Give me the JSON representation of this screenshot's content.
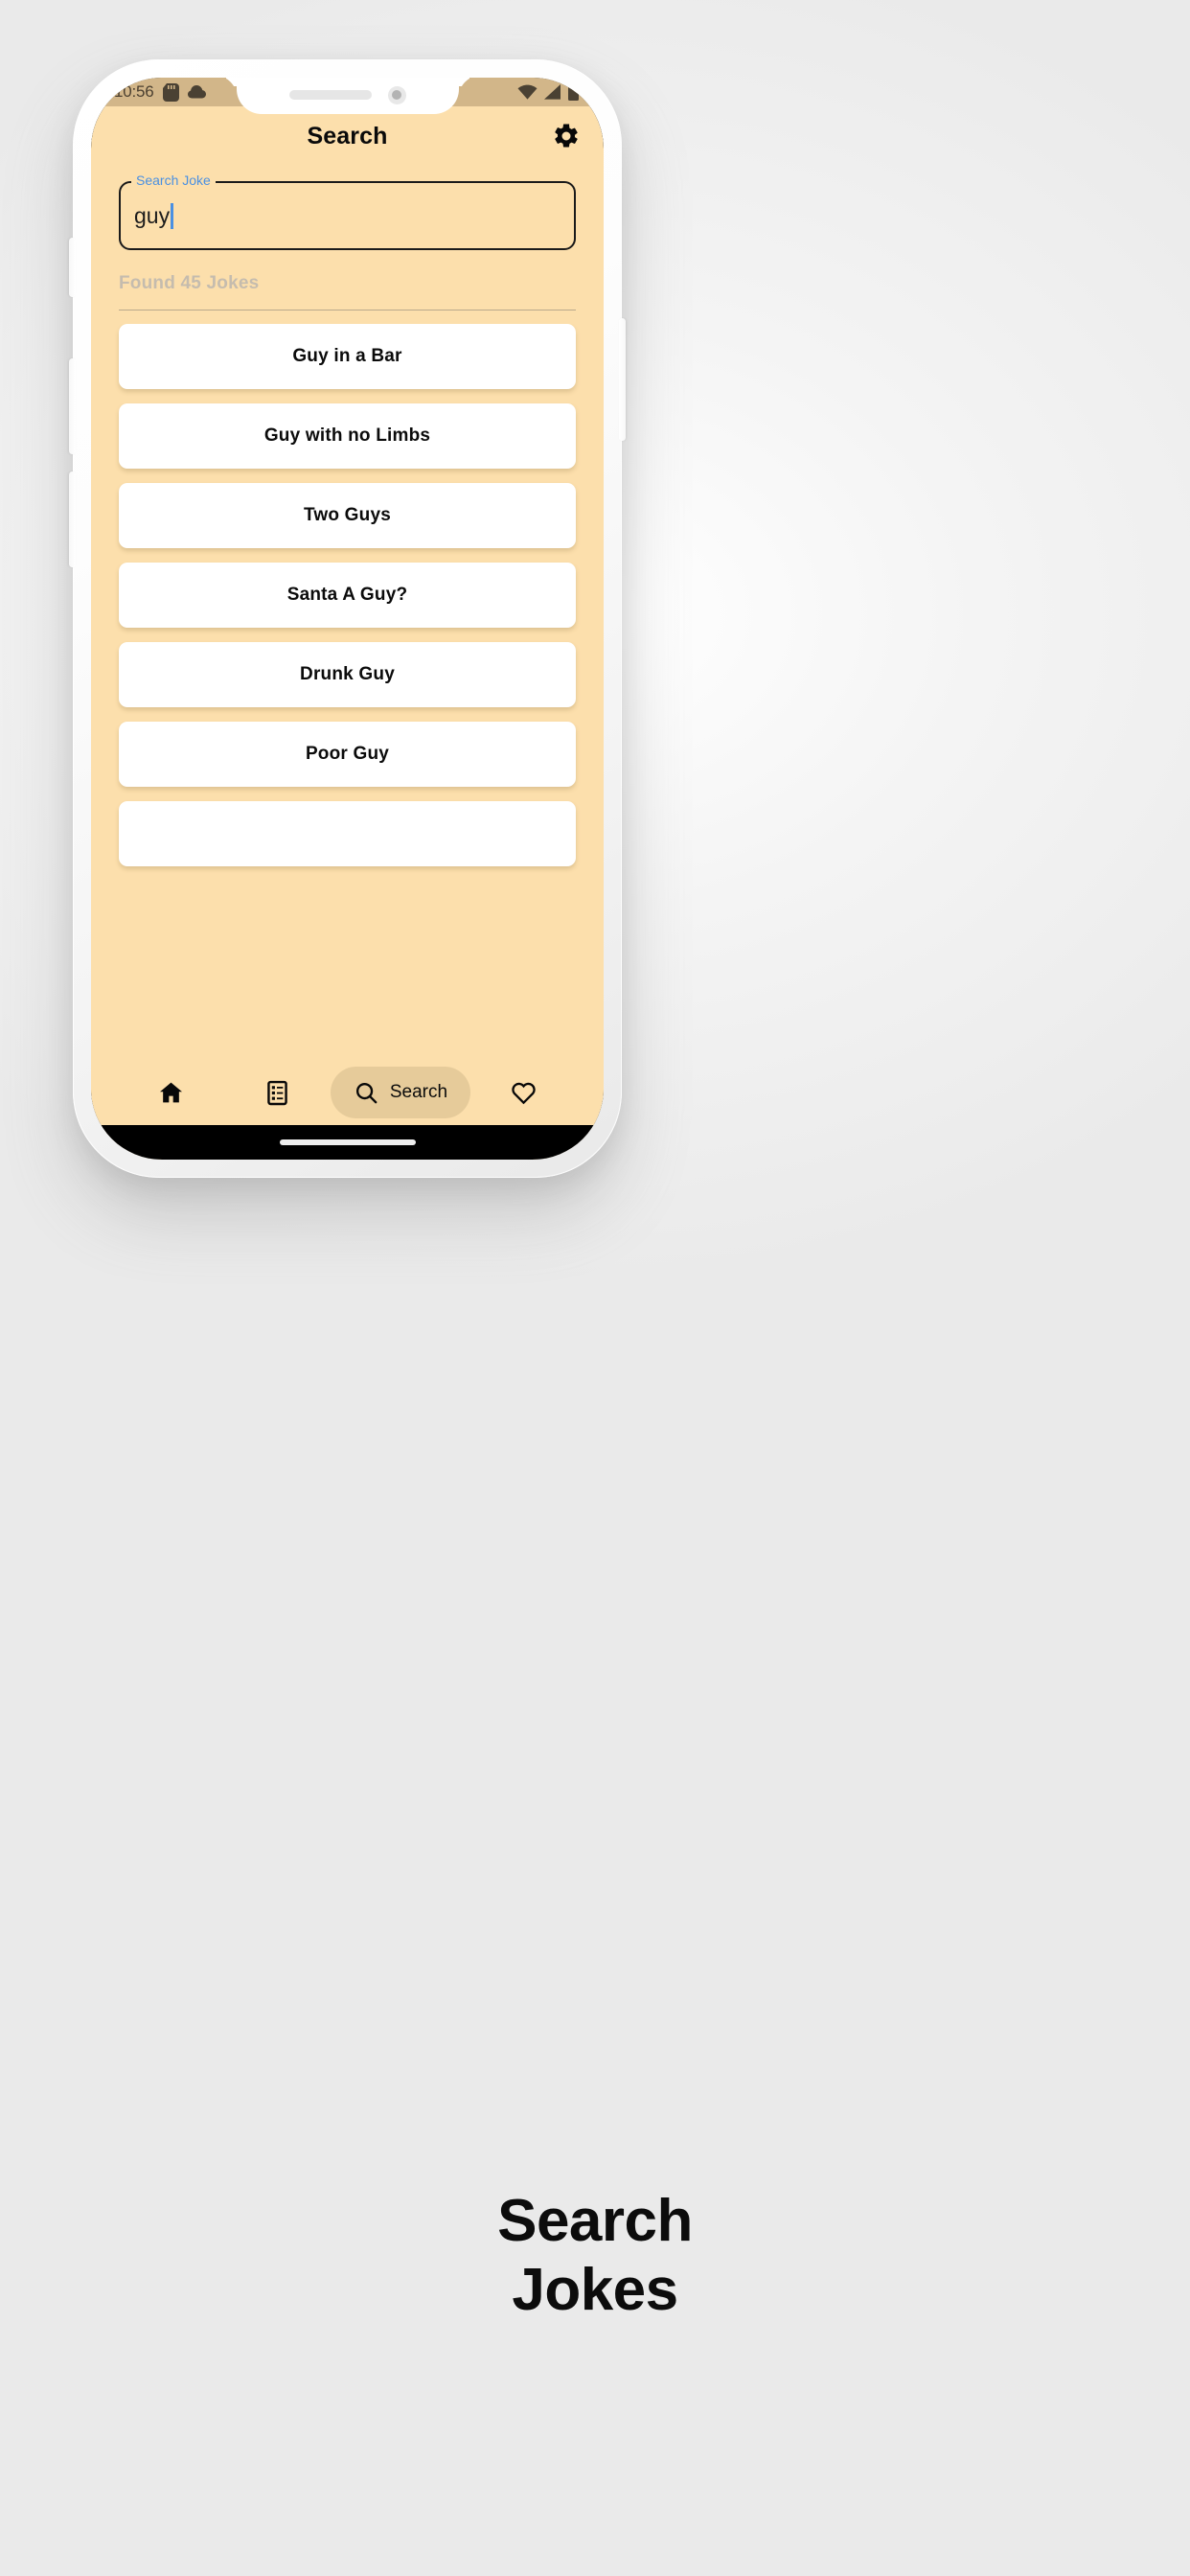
{
  "statusbar": {
    "time": "10:56",
    "icons": [
      "sd-card-icon",
      "cloud-icon",
      "wifi-icon",
      "signal-icon",
      "battery-icon"
    ]
  },
  "appbar": {
    "title": "Search",
    "settings_icon": "gear-icon"
  },
  "search": {
    "label": "Search Joke",
    "value": "guy",
    "placeholder": "Search Joke"
  },
  "results": {
    "found_text": "Found 45 Jokes",
    "count": 45,
    "jokes": [
      {
        "title": "Guy in a Bar"
      },
      {
        "title": "Guy with no Limbs"
      },
      {
        "title": "Two Guys"
      },
      {
        "title": "Santa A Guy?"
      },
      {
        "title": "Drunk Guy"
      },
      {
        "title": "Poor Guy"
      }
    ]
  },
  "bottom_nav": {
    "items": [
      {
        "name": "home",
        "icon": "home-icon",
        "label": "",
        "active": false
      },
      {
        "name": "list",
        "icon": "list-icon",
        "label": "",
        "active": false
      },
      {
        "name": "search",
        "icon": "search-icon",
        "label": "Search",
        "active": true
      },
      {
        "name": "favorite",
        "icon": "heart-icon",
        "label": "",
        "active": false
      }
    ],
    "search_label": "Search"
  },
  "caption": {
    "line1": "Search",
    "line2": "Jokes"
  },
  "colors": {
    "app_background": "#fcdfac",
    "status_bar": "#d2b689",
    "card": "#ffffff",
    "accent_blue": "#4a90e2",
    "nav_active_pill": "#e6cb9a",
    "found_text": "#c5bcae"
  }
}
